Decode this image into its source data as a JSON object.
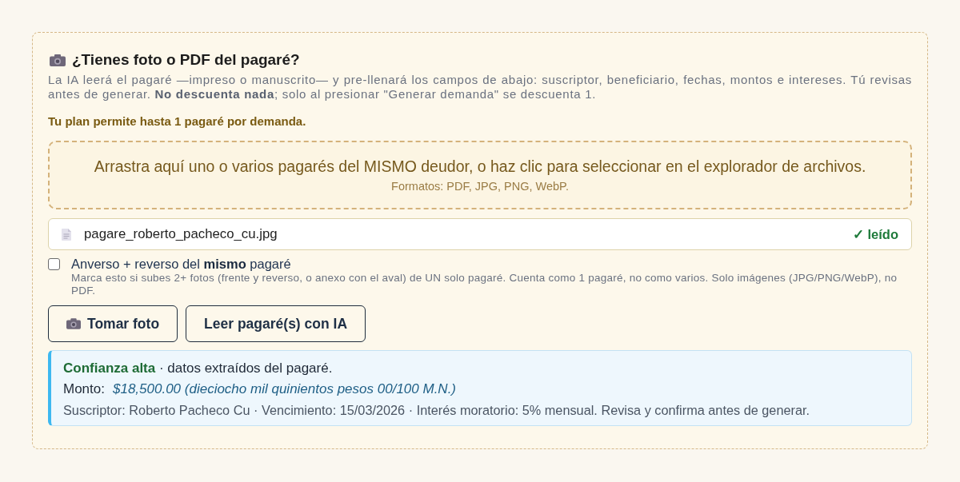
{
  "upload_panel": {
    "title": "¿Tienes foto o PDF del pagaré?",
    "description": "La IA leerá el pagaré —impreso o manuscrito— y pre-llenará los campos de abajo: suscriptor, beneficiario, fechas, montos e intereses. Tú revisas antes de generar. **No descuenta nada**; solo al presionar \"Generar demanda\" se descuenta 1.",
    "plan_note": "Tu plan permite hasta 1 pagaré por demanda.",
    "dropzone": {
      "text": "Arrastra aquí uno o varios pagarés del MISMO deudor, o haz clic para seleccionar en el explorador de archivos.",
      "formats": "Formatos: PDF, JPG, PNG, WebP."
    },
    "files": [
      {
        "name": "pagare_roberto_pacheco_cu.jpg",
        "status": "✓ leído"
      }
    ],
    "same_note_option": {
      "label": "Anverso + reverso del **mismo** pagaré",
      "hint": "Marca esto si subes 2+ fotos (frente y reverso, o anexo con el aval) de UN solo pagaré. Cuenta como 1 pagaré, no como varios. Solo imágenes (JPG/PNG/WebP), no PDF.",
      "checked": false
    },
    "buttons": [
      {
        "label": "Tomar foto",
        "kind": "camera"
      },
      {
        "label": "Leer pagaré(s) con IA",
        "kind": "plain"
      }
    ],
    "result": {
      "headline": "**Confianza alta** · datos extraídos del pagaré.",
      "amount_label": "Monto:",
      "amount": "$18,500.00 (dieciocho mil quinientos pesos 00/100 M.N.)",
      "details": "Suscriptor: Roberto Pacheco Cu · Vencimiento: 15/03/2026 · Interés moratorio: 5% mensual. Revisa y confirma antes de generar."
    }
  }
}
